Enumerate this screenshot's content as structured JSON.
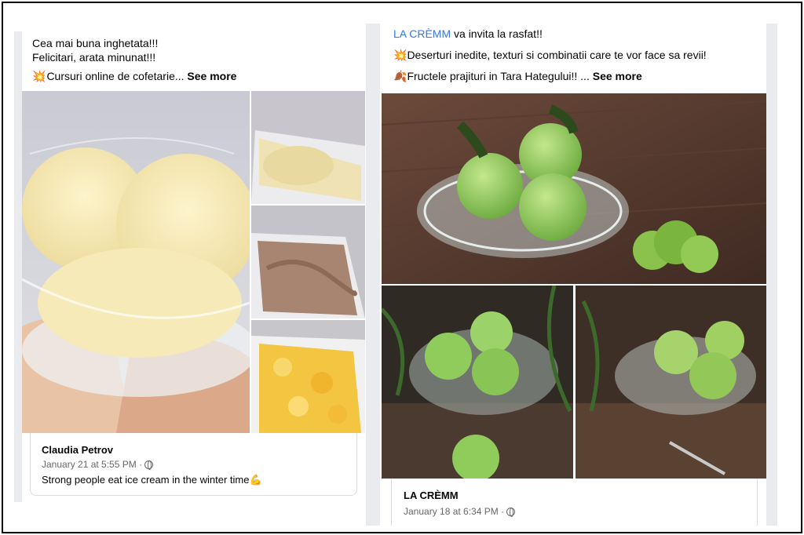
{
  "left_post": {
    "lines": [
      "Cea mai buna inghetata!!!",
      "Felicitari, arata minunat!!!"
    ],
    "teaser_emoji": "💥",
    "teaser_text": "Cursuri online de cofetarie...",
    "see_more": "See more",
    "comment": {
      "author": "Claudia Petrov",
      "time": "January 21 at 5:55 PM ·",
      "text": "Strong people eat ice cream in the winter time",
      "text_emoji": "💪"
    }
  },
  "right_post": {
    "page_link": "LA CRÈMM",
    "line1_rest": " va invita la rasfat!!",
    "line2_emoji": "💥",
    "line2_text": "Deserturi inedite, texturi si combinatii care te vor face sa revii!",
    "line3_emoji": "🍂",
    "line3_text": "Fructele prajituri in Tara Hategului!! ...",
    "see_more": "See more",
    "footer": {
      "author": "LA CRÈMM",
      "time": "January 18 at 6:34 PM ·"
    }
  },
  "icons": {
    "globe": "globe-icon"
  },
  "colors": {
    "link": "#3578e5",
    "meta": "#65676b",
    "gutter": "#e9ebee"
  }
}
